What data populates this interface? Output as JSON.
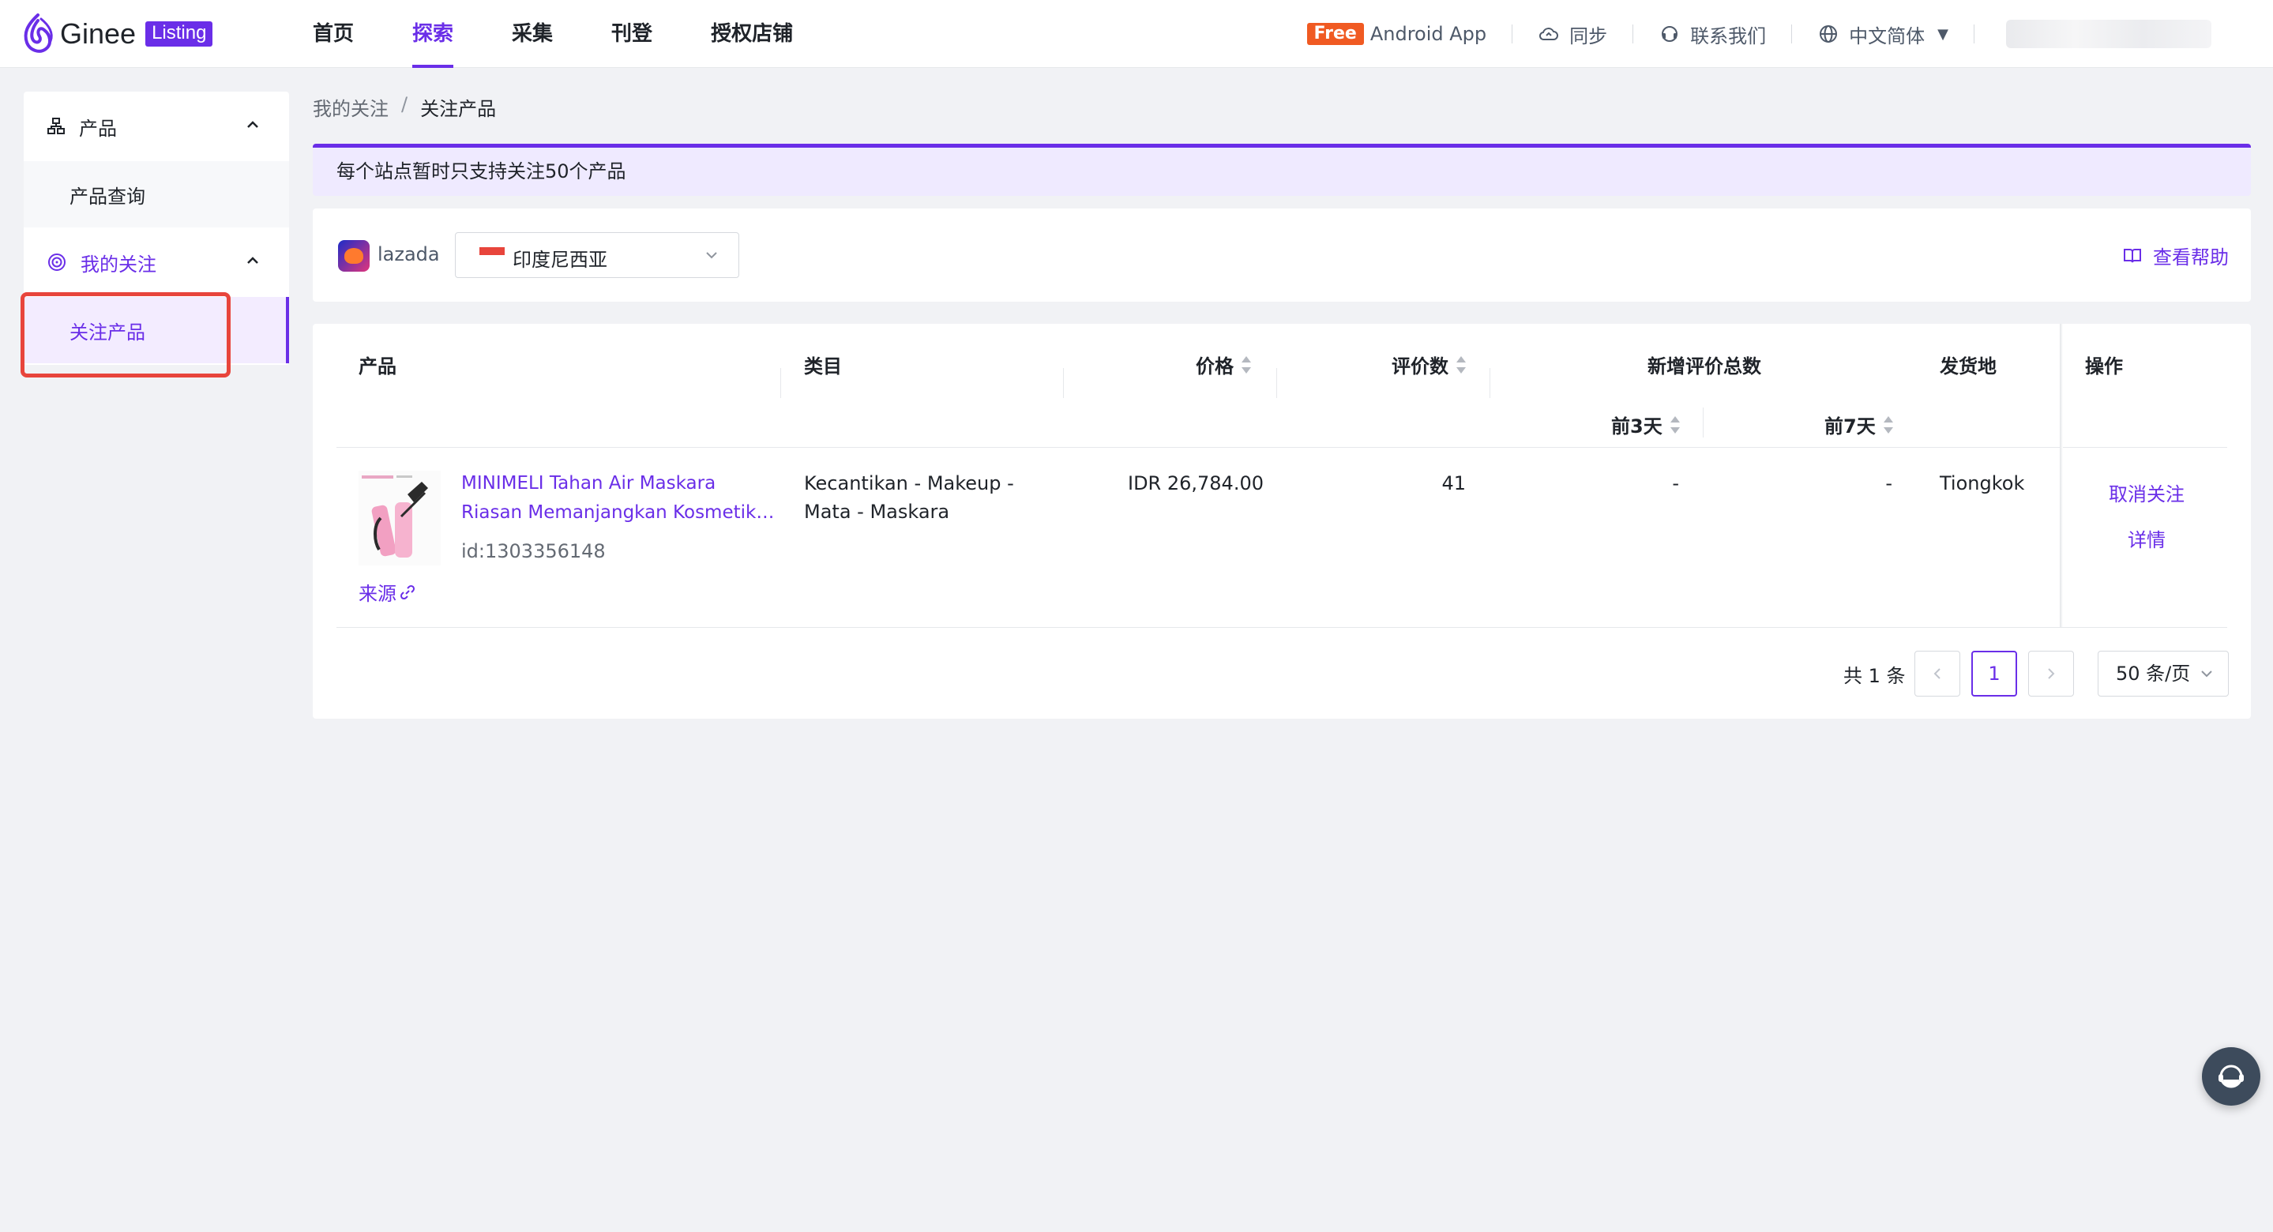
{
  "header": {
    "brand": "Ginee",
    "badge": "Listing",
    "nav": [
      {
        "label": "首页"
      },
      {
        "label": "探索"
      },
      {
        "label": "采集"
      },
      {
        "label": "刊登"
      },
      {
        "label": "授权店铺"
      }
    ],
    "free_badge": "Free",
    "android_app": "Android App",
    "sync": "同步",
    "contact": "联系我们",
    "language": "中文简体"
  },
  "sidebar": {
    "group1": "产品",
    "group1_item": "产品查询",
    "group2": "我的关注",
    "group2_item": "关注产品"
  },
  "breadcrumb": {
    "parent": "我的关注",
    "separator": "/",
    "current": "关注产品"
  },
  "notice": "每个站点暂时只支持关注50个产品",
  "filter": {
    "platform": "lazada",
    "country": "印度尼西亚",
    "help": "查看帮助"
  },
  "table": {
    "columns": {
      "product": "产品",
      "category": "类目",
      "price": "价格",
      "reviews": "评价数",
      "new_reviews": "新增评价总数",
      "last3": "前3天",
      "last7": "前7天",
      "ship_from": "发货地",
      "actions": "操作"
    },
    "rows": [
      {
        "title_line1": "MINIMELI Tahan Air Maskara",
        "title_line2": "Riasan Memanjangkan Kosmetik Bulu Mata",
        "id": "id:1303356148",
        "source": "来源",
        "category_line1": "Kecantikan - Makeup -",
        "category_line2": "Mata - Maskara",
        "price": "IDR 26,784.00",
        "reviews": "41",
        "last3": "-",
        "last7": "-",
        "ship_from": "Tiongkok",
        "unfollow": "取消关注",
        "details": "详情"
      }
    ]
  },
  "pagination": {
    "total": "共 1 条",
    "current_page": "1",
    "page_size": "50 条/页"
  },
  "colors": {
    "accent": "#6a2ee8",
    "highlight": "#e8453c",
    "free": "#f05a22"
  }
}
